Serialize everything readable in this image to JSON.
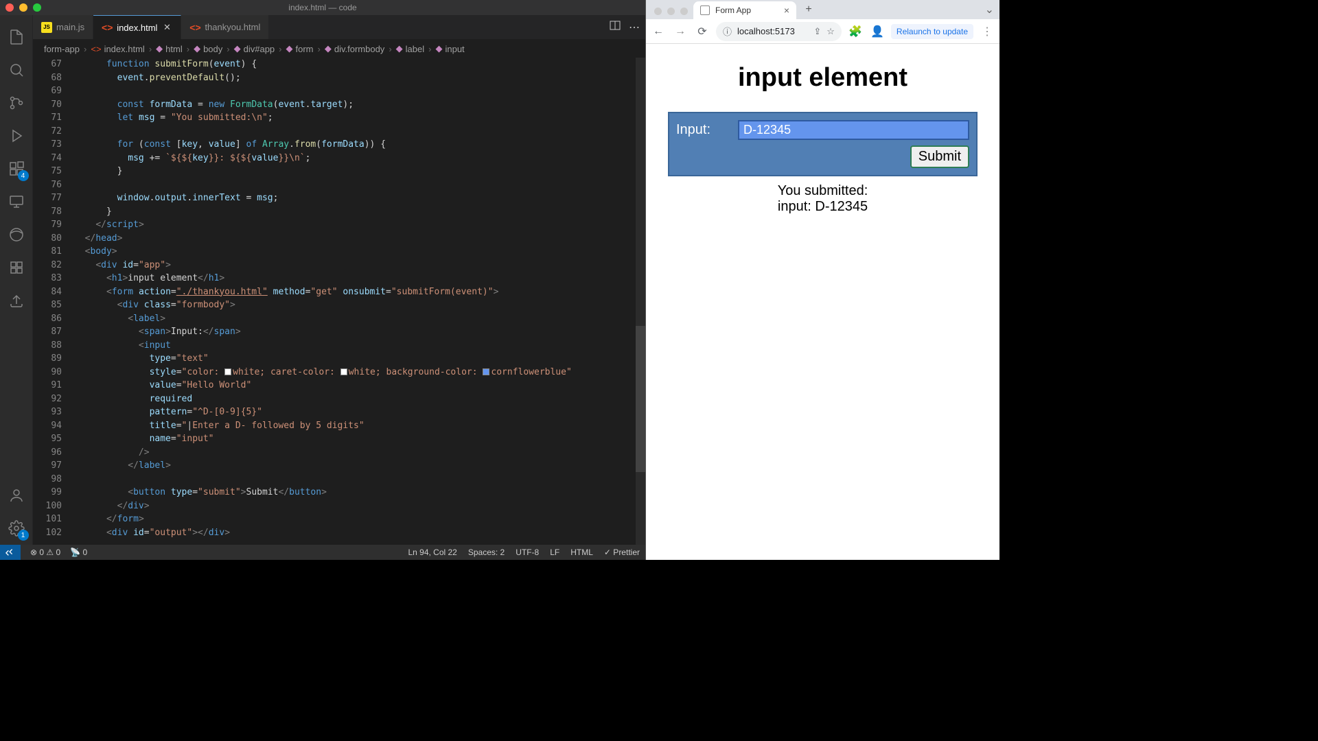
{
  "vscode": {
    "title": "index.html — code",
    "tabs": [
      {
        "icon": "JS",
        "label": "main.js",
        "active": false
      },
      {
        "icon": "<>",
        "label": "index.html",
        "active": true,
        "dirty": false,
        "closeable": true
      },
      {
        "icon": "<>",
        "label": "thankyou.html",
        "active": false
      }
    ],
    "breadcrumbs": [
      "form-app",
      "index.html",
      "html",
      "body",
      "div#app",
      "form",
      "div.formbody",
      "label",
      "input"
    ],
    "activity_badges": {
      "extensions": "4",
      "settings": "1"
    },
    "linenumbers_start": 67,
    "linenumbers_end": 102,
    "cursor_text": "|",
    "statusbar": {
      "errors": "0",
      "warnings": "0",
      "ports": "0",
      "cursor": "Ln 94, Col 22",
      "spaces": "Spaces: 2",
      "encoding": "UTF-8",
      "eol": "LF",
      "lang": "HTML",
      "formatter": "✓ Prettier"
    },
    "code_text": {
      "l67": "function submitForm(event) {",
      "l68": "  event.preventDefault();",
      "l70": "  const formData = new FormData(event.target);",
      "l71": "  let msg = \"You submitted:\\n\";",
      "l73": "  for (const [key, value] of Array.from(formData)) {",
      "l74": "    msg += `${key}: ${value}\\n`;",
      "l75": "  }",
      "l77": "  window.output.innerText = msg;",
      "l78": "}",
      "l79": "</script_>",
      "l80": "</head>",
      "l81": "<body>",
      "l82": "  <div id=\"app\">",
      "l83": "    <h1>input element</h1>",
      "l84": "    <form action=\"./thankyou.html\" method=\"get\" onsubmit=\"submitForm(event)\">",
      "l85": "      <div class=\"formbody\">",
      "l86": "        <label>",
      "l87": "          <span>Input:</span>",
      "l88": "          <input",
      "l89": "            type=\"text\"",
      "l90": "            style=\"color: white; caret-color: white; background-color: cornflowerblue\"",
      "l91": "            value=\"Hello World\"",
      "l92": "            required",
      "l93": "            pattern=\"^D-[0-9]{5}\"",
      "l94": "            title=\"Enter a D- followed by 5 digits\"",
      "l95": "            name=\"input\"",
      "l96": "          />",
      "l97": "        </label>",
      "l99": "        <button type=\"submit\">Submit</button>",
      "l100": "      </div>",
      "l101": "    </form>",
      "l102": "    <div id=\"output\"></div>"
    }
  },
  "browser": {
    "tab_title": "Form App",
    "url": "localhost:5173",
    "relaunch": "Relaunch to update",
    "page": {
      "heading": "input element",
      "label": "Input:",
      "input_value": "D-12345",
      "submit": "Submit",
      "output": "You submitted:\ninput: D-12345"
    }
  }
}
